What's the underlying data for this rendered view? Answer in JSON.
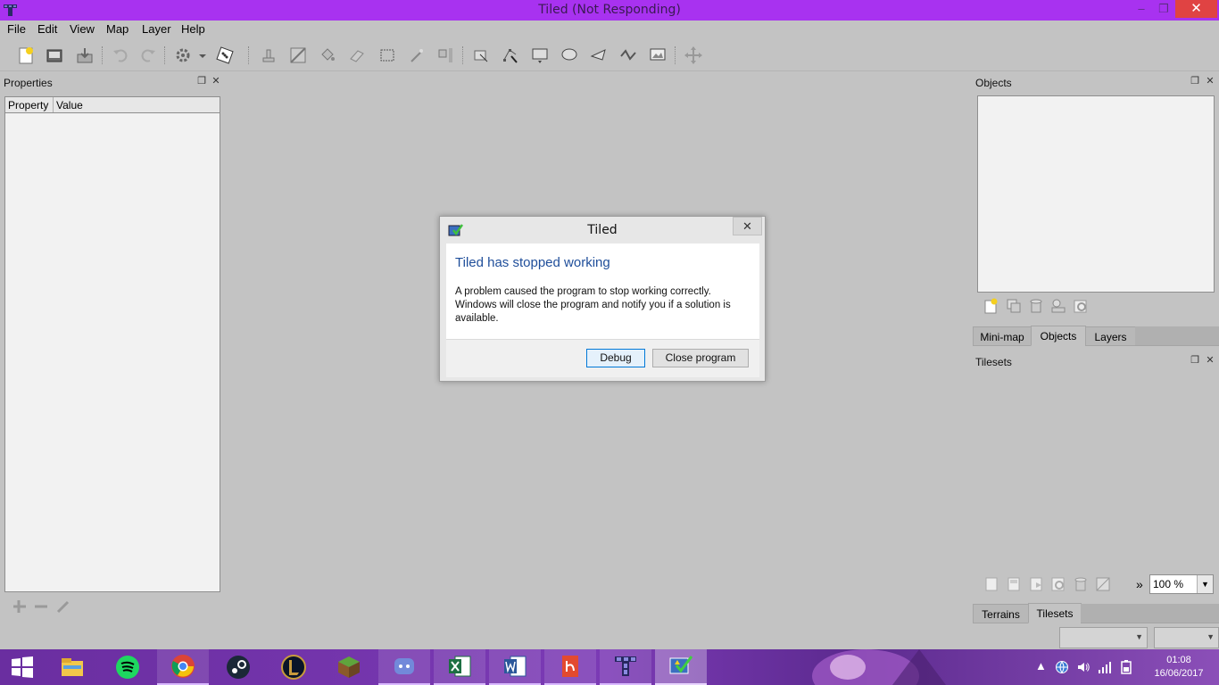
{
  "window": {
    "title": "Tiled (Not Responding)",
    "min": "–",
    "max": "❐",
    "close": "✕"
  },
  "menu": [
    "File",
    "Edit",
    "View",
    "Map",
    "Layer",
    "Help"
  ],
  "properties": {
    "title": "Properties",
    "col_property": "Property",
    "col_value": "Value"
  },
  "objects_panel": {
    "title": "Objects",
    "tabs": [
      "Mini-map",
      "Objects",
      "Layers"
    ],
    "active_tab": "Objects"
  },
  "tilesets_panel": {
    "title": "Tilesets",
    "tabs": [
      "Terrains",
      "Tilesets"
    ],
    "active_tab": "Tilesets",
    "zoom": "100 %",
    "more": "»"
  },
  "dialog": {
    "title": "Tiled",
    "heading": "Tiled has stopped working",
    "message": "A problem caused the program to stop working correctly. Windows will close the program and notify you if a solution is available.",
    "debug_label": "Debug",
    "close_label": "Close program"
  },
  "taskbar": {
    "apps": [
      "start",
      "file-explorer",
      "spotify",
      "chrome",
      "steam",
      "league-of-legends",
      "minecraft",
      "discord",
      "excel",
      "word",
      "acrobat",
      "tiled",
      "error-reporting"
    ],
    "time": "01:08",
    "date": "16/06/2017"
  },
  "colors": {
    "titlebar": "#a832f0",
    "close": "#e04343",
    "dialog_heading": "#1f4e9a",
    "taskbar": "#6a2ea0"
  }
}
